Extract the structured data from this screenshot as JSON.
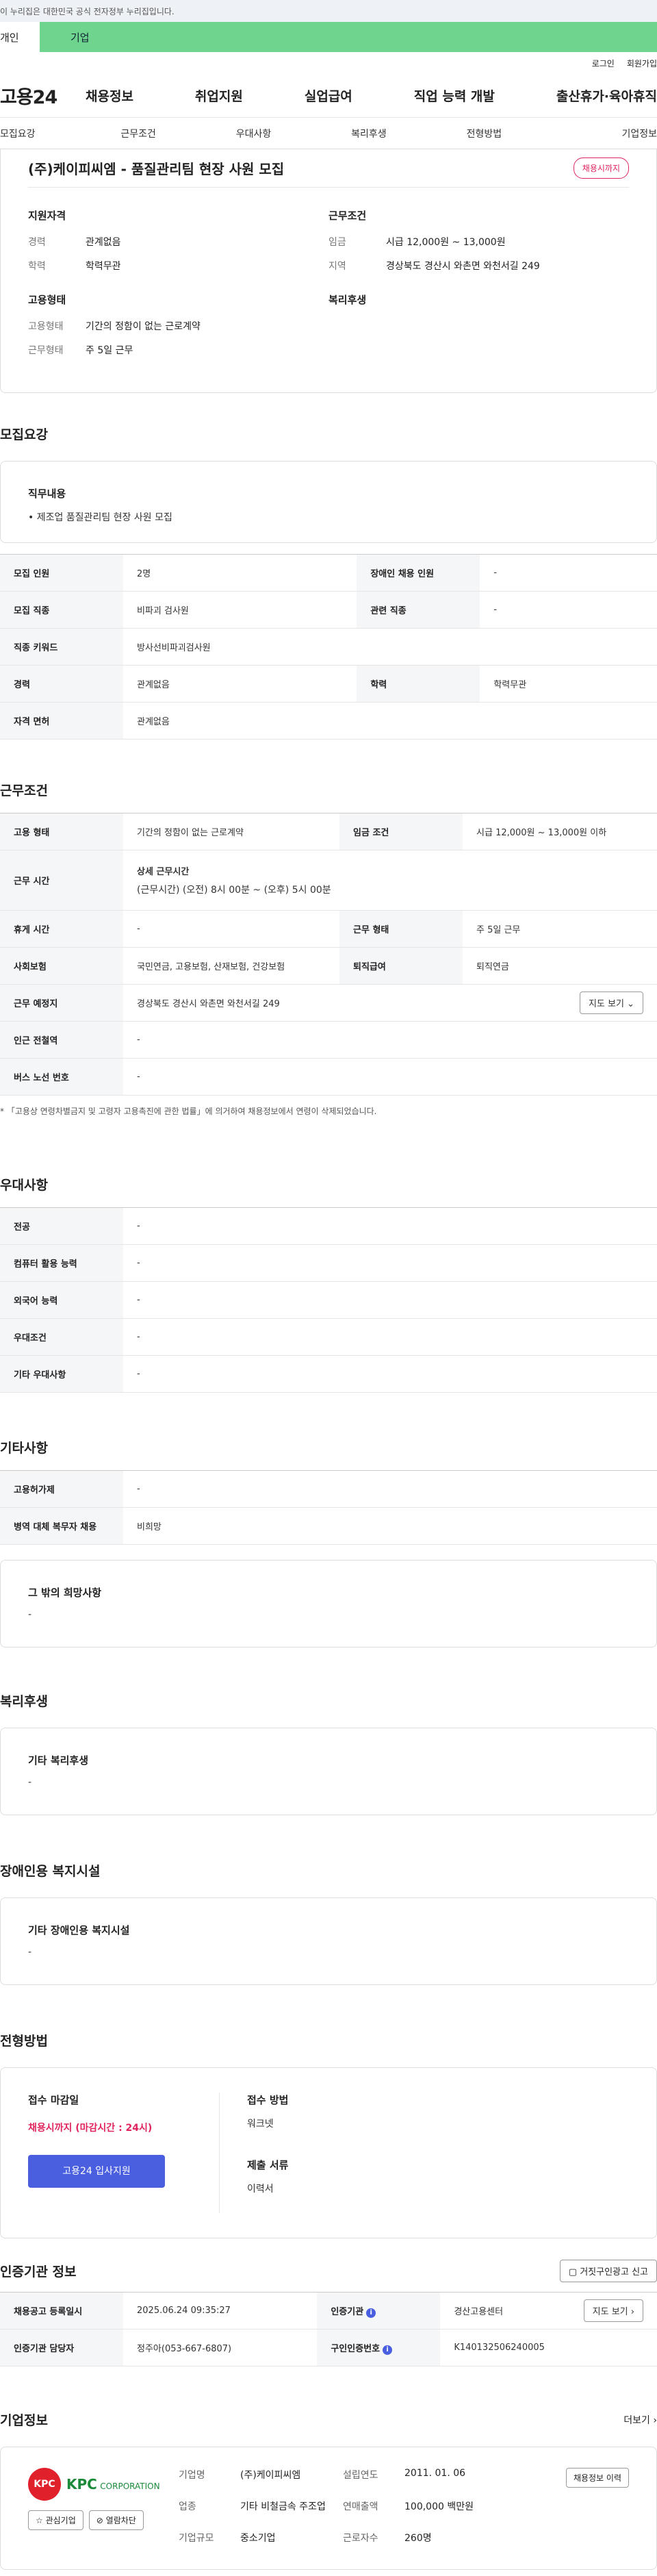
{
  "gov_notice": "이 누리집은 대한민국 공식 전자정부 누리집입니다.",
  "tabs": {
    "personal": "개인",
    "company": "기업"
  },
  "util": {
    "login": "로그인",
    "join": "회원가입"
  },
  "logo": "고용24",
  "gnb": [
    "채용정보",
    "취업지원",
    "실업급여",
    "직업 능력 개발",
    "출산휴가·육아휴직"
  ],
  "subnav": [
    "모집요강",
    "근무조건",
    "우대사항",
    "복리후생",
    "전형방법",
    "기업정보"
  ],
  "summary": {
    "title": "(주)케이피씨엠 - 품질관리팀 현장 사원 모집",
    "badge": "채용시까지",
    "qual_h": "지원자격",
    "qual": [
      {
        "k": "경력",
        "v": "관계없음"
      },
      {
        "k": "학력",
        "v": "학력무관"
      }
    ],
    "cond_h": "근무조건",
    "cond": [
      {
        "k": "임금",
        "v": "시급 12,000원 ~ 13,000원"
      },
      {
        "k": "지역",
        "v": "경상북도 경산시 와촌면 와천서길 249"
      }
    ],
    "emp_h": "고용형태",
    "emp": [
      {
        "k": "고용형태",
        "v": "기간의 정함이 없는 근로계약"
      },
      {
        "k": "근무형태",
        "v": "주 5일 근무"
      }
    ],
    "welfare_h": "복리후생"
  },
  "recruit": {
    "title": "모집요강",
    "duty_h": "직무내용",
    "duty": "• 제조업 품질관리팀 현장 사원 모집",
    "rows": [
      {
        "k1": "모집 인원",
        "v1": "2명",
        "k2": "장애인 채용 인원",
        "v2": "-"
      },
      {
        "k1": "모집 직종",
        "v1": "비파괴 검사원",
        "k2": "관련 직종",
        "v2": "-"
      },
      {
        "k1": "직종 키워드",
        "v1": "방사선비파괴검사원"
      },
      {
        "k1": "경력",
        "v1": "관계없음",
        "k2": "학력",
        "v2": "학력무관"
      },
      {
        "k1": "자격 면허",
        "v1": "관계없음"
      }
    ]
  },
  "work": {
    "title": "근무조건",
    "emp_type_k": "고용 형태",
    "emp_type_v": "기간의 정함이 없는 근로계약",
    "wage_k": "임금 조건",
    "wage_v": "시급 12,000원 ~ 13,000원 이하",
    "hours_k": "근무 시간",
    "hours_h": "상세 근무시간",
    "hours_v": "(근무시간) (오전) 8시 00분 ~ (오후) 5시 00분",
    "rest_k": "휴게 시간",
    "rest_v": "-",
    "shift_k": "근무 형태",
    "shift_v": "주 5일 근무",
    "ins_k": "사회보험",
    "ins_v": "국민연금, 고용보험, 산재보험, 건강보험",
    "ret_k": "퇴직급여",
    "ret_v": "퇴직연금",
    "place_k": "근무 예정지",
    "place_v": "경상북도 경산시 와촌면 와천서길 249",
    "map_btn": "지도 보기",
    "subway_k": "인근 전철역",
    "subway_v": "-",
    "bus_k": "버스 노선 번호",
    "bus_v": "-",
    "note": "* 「고용상 연령차별금지 및 고령자 고용촉진에 관한 법률」에 의거하여 채용정보에서 연령이 삭제되었습니다."
  },
  "pref": {
    "title": "우대사항",
    "rows": [
      {
        "k": "전공",
        "v": "-"
      },
      {
        "k": "컴퓨터 활용 능력",
        "v": "-"
      },
      {
        "k": "외국어 능력",
        "v": "-"
      },
      {
        "k": "우대조건",
        "v": "-"
      },
      {
        "k": "기타 우대사항",
        "v": "-"
      }
    ]
  },
  "etc": {
    "title": "기타사항",
    "rows": [
      {
        "k": "고용허가제",
        "v": "-"
      },
      {
        "k": "병역 대체 복무자 채용",
        "v": "비희망"
      }
    ],
    "other_h": "그 밖의 희망사항",
    "other_v": "-"
  },
  "welfare": {
    "title": "복리후생",
    "h": "기타 복리후생",
    "v": "-"
  },
  "disability": {
    "title": "장애인용 복지시설",
    "h": "기타 장애인용 복지시설",
    "v": "-"
  },
  "apply": {
    "title": "전형방법",
    "deadline_h": "접수 마감일",
    "deadline_v": "채용시까지 (마감시간 : 24시)",
    "btn": "고용24 입사지원",
    "method_h": "접수 방법",
    "method_v": "워크넷",
    "docs_h": "제출 서류",
    "docs_v": "이력서"
  },
  "cert": {
    "title": "인증기관 정보",
    "report_btn": "거짓구인광고 신고",
    "reg_k": "채용공고 등록일시",
    "reg_v": "2025.06.24 09:35:27",
    "org_k": "인증기관",
    "org_v": "경산고용센터",
    "map_btn": "지도 보기",
    "mgr_k": "인증기관 담당자",
    "mgr_v": "정주아(053-667-6807)",
    "id_k": "구인인증번호",
    "id_v": "K140132506240005"
  },
  "company": {
    "title": "기업정보",
    "more": "더보기",
    "logo_mark": "KPC",
    "logo_text": "KPC",
    "logo_sub": "CORPORATION",
    "fav_btn": "관심기업",
    "block_btn": "열람차단",
    "name_k": "기업명",
    "name_v": "(주)케이피씨엠",
    "ind_k": "업종",
    "ind_v": "기타 비철금속 주조업",
    "size_k": "기업규모",
    "size_v": "중소기업",
    "est_k": "설립연도",
    "est_v": "2011. 01. 06",
    "sales_k": "연매출액",
    "sales_v": "100,000 백만원",
    "emp_k": "근로자수",
    "emp_v": "260명",
    "hist_btn": "채용정보 이력"
  }
}
